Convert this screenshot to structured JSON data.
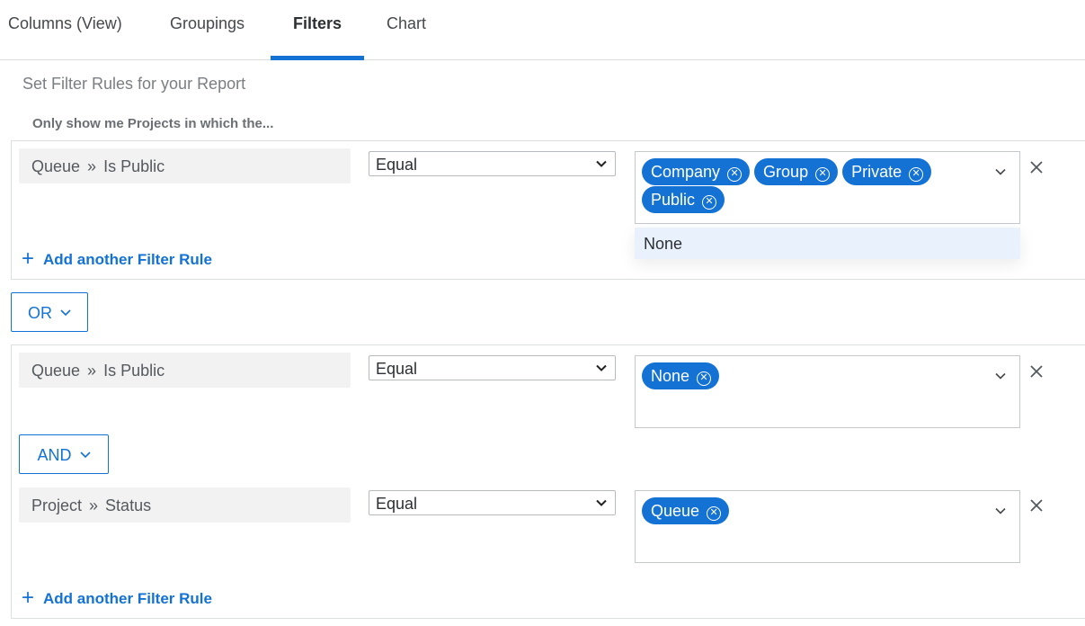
{
  "tabs": [
    {
      "label": "Columns (View)"
    },
    {
      "label": "Groupings"
    },
    {
      "label": "Filters",
      "active": true
    },
    {
      "label": "Chart"
    }
  ],
  "section_title": "Set Filter Rules for your Report",
  "subtitle": "Only show me Projects in which the...",
  "separator": "»",
  "groups": [
    {
      "rules": [
        {
          "object": "Queue",
          "field": "Is Public",
          "operator": "Equal",
          "values": [
            "Company",
            "Group",
            "Private",
            "Public"
          ]
        }
      ],
      "add_rule_label": "Add another Filter Rule",
      "dropdown_options": [
        "None"
      ]
    },
    {
      "rules": [
        {
          "object": "Queue",
          "field": "Is Public",
          "operator": "Equal",
          "values": [
            "None"
          ]
        },
        {
          "object": "Project",
          "field": "Status",
          "operator": "Equal",
          "values": [
            "Queue"
          ]
        }
      ],
      "inner_logic": "AND",
      "add_rule_label": "Add another Filter Rule"
    }
  ],
  "group_logic": "OR",
  "colors": {
    "accent": "#1372d4",
    "field_bg": "#f2f2f2",
    "dropdown_highlight": "#e9f2fc"
  }
}
